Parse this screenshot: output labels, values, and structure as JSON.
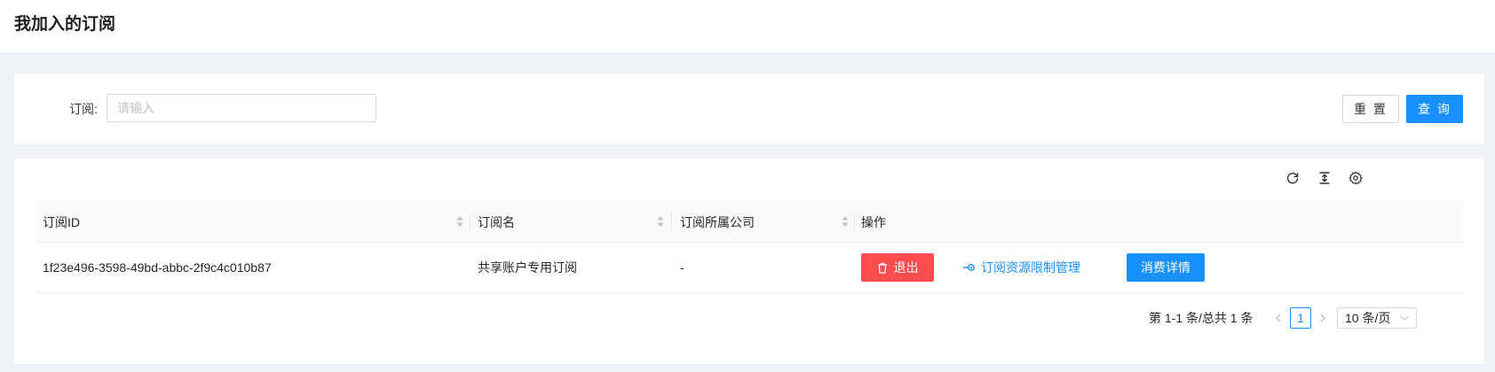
{
  "header": {
    "title": "我加入的订阅"
  },
  "search": {
    "label": "订阅:",
    "placeholder": "请输入",
    "value": "",
    "reset_label": "重 置",
    "query_label": "查 询"
  },
  "toolbar": {
    "icons": [
      "reload-icon",
      "column-height-icon",
      "setting-icon"
    ]
  },
  "table": {
    "columns": [
      {
        "label": "订阅ID",
        "sortable": true
      },
      {
        "label": "订阅名",
        "sortable": true
      },
      {
        "label": "订阅所属公司",
        "sortable": true
      },
      {
        "label": "操作",
        "sortable": false
      }
    ],
    "rows": [
      {
        "id": "1f23e496-3598-49bd-abbc-2f9c4c010b87",
        "name": "共享账户专用订阅",
        "company": "-",
        "actions": {
          "exit_label": "退出",
          "manage_label": "订阅资源限制管理",
          "consume_label": "消费详情"
        }
      }
    ]
  },
  "pagination": {
    "total_text": "第 1-1 条/总共 1 条",
    "current_page": "1",
    "page_size": "10 条/页"
  },
  "colors": {
    "primary": "#1890ff",
    "danger": "#ff4d4f",
    "background": "#f0f2f5"
  }
}
